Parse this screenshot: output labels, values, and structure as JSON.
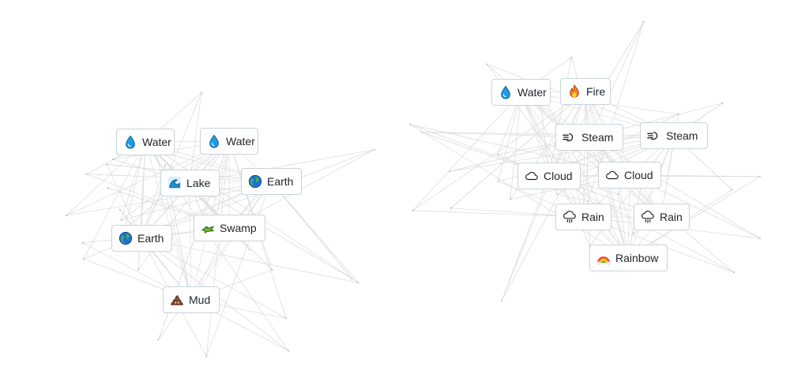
{
  "board": {
    "tiles": [
      {
        "id": "water-1",
        "label": "Water",
        "icon": "water-drop-icon"
      },
      {
        "id": "water-2",
        "label": "Water",
        "icon": "water-drop-icon"
      },
      {
        "id": "lake",
        "label": "Lake",
        "icon": "wave-icon"
      },
      {
        "id": "earth-1",
        "label": "Earth",
        "icon": "globe-icon"
      },
      {
        "id": "swamp",
        "label": "Swamp",
        "icon": "crocodile-icon"
      },
      {
        "id": "earth-2",
        "label": "Earth",
        "icon": "globe-icon"
      },
      {
        "id": "mud",
        "label": "Mud",
        "icon": "mud-pile-icon"
      },
      {
        "id": "water-3",
        "label": "Water",
        "icon": "water-drop-icon"
      },
      {
        "id": "fire",
        "label": "Fire",
        "icon": "flame-icon"
      },
      {
        "id": "steam-1",
        "label": "Steam",
        "icon": "steam-puff-icon"
      },
      {
        "id": "steam-2",
        "label": "Steam",
        "icon": "steam-puff-icon"
      },
      {
        "id": "cloud-1",
        "label": "Cloud",
        "icon": "cloud-icon"
      },
      {
        "id": "cloud-2",
        "label": "Cloud",
        "icon": "cloud-icon"
      },
      {
        "id": "rain-1",
        "label": "Rain",
        "icon": "rain-cloud-icon"
      },
      {
        "id": "rain-2",
        "label": "Rain",
        "icon": "rain-cloud-icon"
      },
      {
        "id": "rainbow",
        "label": "Rainbow",
        "icon": "rainbow-icon"
      }
    ]
  },
  "colors": {
    "tile_border": "#c9d3dc",
    "tile_text": "#1f2328",
    "link_line": "#d9d9d9",
    "water": "#1e9be6",
    "earth_land": "#43b04a",
    "earth_sea": "#1e6fd9",
    "fire": "#f77f1c",
    "mud": "#8a4b2a"
  }
}
